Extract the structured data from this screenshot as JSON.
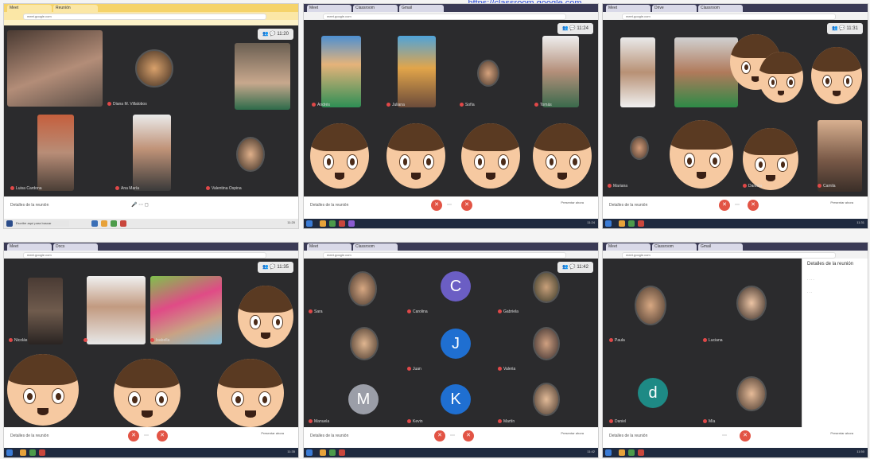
{
  "header_link": "https://classroom.google.com",
  "colors": {
    "accent_red": "#e25445",
    "stage_bg": "#2b2b2d",
    "link_blue": "#2a4bd6",
    "avatar_purple": "#6b5ec4",
    "avatar_blue": "#1f6fd1",
    "avatar_gray": "#9b9ea8",
    "avatar_teal": "#1e8a85"
  },
  "panels": [
    {
      "tabs": [
        "Meet",
        "Reunión"
      ],
      "url": "meet.google.com",
      "bottom_label": "Detalles de la reunión",
      "end_call_icon": "phone-end-icon",
      "names": [
        "Diana M. Villalobos",
        "Luisa Cardona",
        "Alison Andrade",
        "Ana María",
        "Valentina Ospina"
      ],
      "taskbar_search": "Escribe aquí para buscar",
      "clock": "11:20"
    },
    {
      "tabs": [
        "Meet",
        "Classroom",
        "Gmail"
      ],
      "url": "meet.google.com",
      "bottom_label": "Detalles de la reunión",
      "present_label": "Presentar ahora",
      "names": [
        "Andrés",
        "Juliana",
        "Sofía",
        "Tomás"
      ],
      "clock": "11:24"
    },
    {
      "tabs": [
        "Meet",
        "Drive",
        "Classroom"
      ],
      "url": "meet.google.com",
      "bottom_label": "Detalles de la reunión",
      "present_label": "Presentar ahora",
      "names": [
        "Mariana",
        "Daniela",
        "Camila"
      ],
      "clock": "11:31"
    },
    {
      "tabs": [
        "Meet",
        "Docs"
      ],
      "url": "meet.google.com",
      "bottom_label": "Detalles de la reunión",
      "present_label": "Presentar ahora",
      "names": [
        "Nicolás",
        "Laura",
        "Isabella"
      ],
      "clock": "11:35"
    },
    {
      "tabs": [
        "Meet",
        "Classroom"
      ],
      "url": "meet.google.com",
      "bottom_label": "Detalles de la reunión",
      "present_label": "Presentar ahora",
      "letters": [
        "C",
        "J",
        "M",
        "K"
      ],
      "names": [
        "Sara",
        "Carolina",
        "Manuela",
        "Juan",
        "Martín",
        "Kevin",
        "Gabriela",
        "Valeria"
      ],
      "clock": "11:42"
    },
    {
      "tabs": [
        "Meet",
        "Classroom",
        "Gmail"
      ],
      "url": "meet.google.com",
      "bottom_label": "Detalles de la reunión",
      "present_label": "Presentar ahora",
      "letters": [
        "d"
      ],
      "sidepanel_title": "Detalles de la reunión",
      "names": [
        "Paula",
        "Luciana",
        "Daniel",
        "Mía"
      ],
      "clock": "11:50"
    }
  ]
}
